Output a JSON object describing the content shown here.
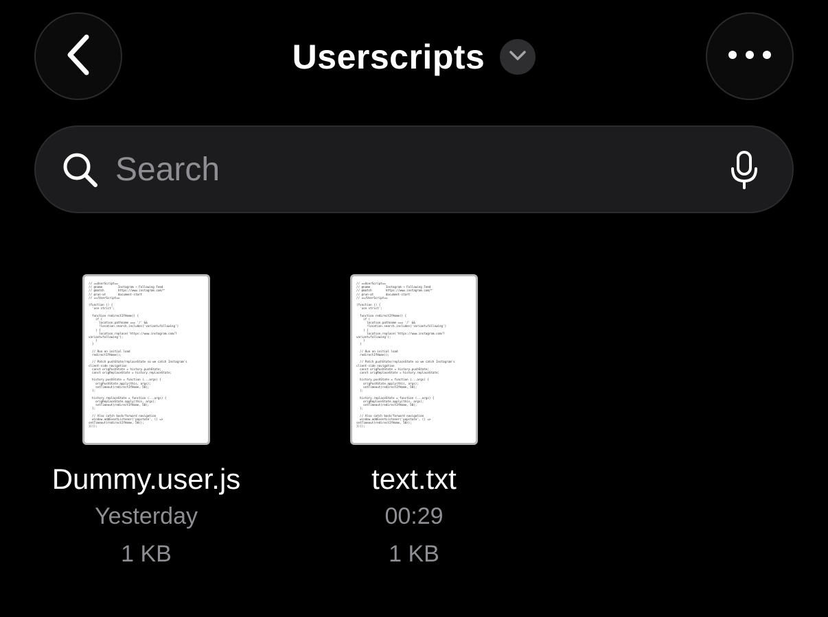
{
  "header": {
    "title": "Userscripts",
    "back_icon": "chevron-left-icon",
    "more_icon": "ellipsis-icon",
    "title_menu_icon": "chevron-down-icon"
  },
  "search": {
    "placeholder": "Search",
    "value": "",
    "search_icon": "search-icon",
    "mic_icon": "microphone-icon"
  },
  "files": [
    {
      "name": "Dummy.user.js",
      "date": "Yesterday",
      "size": "1 KB",
      "preview": "// ==UserScript==\n// @name         Instagram → Following Feed\n// @match        https://www.instagram.com/*\n// @run-at       document-start\n// ==/UserScript==\n\n(function () {\n  'use strict';\n\n  function redirectIfHome() {\n    if (\n      location.pathname === '/' &&\n      !location.search.includes('variant=following')\n    ) {\n      location.replace('https://www.instagram.com/?\nvariant=following');\n    }\n  }\n\n  // Run on initial load\n  redirectIfHome();\n\n  // Patch pushState/replaceState so we catch Instagram's\nclient-side navigation\n  const origPushState = history.pushState;\n  const origReplaceState = history.replaceState;\n\n  history.pushState = function (...args) {\n    origPushState.apply(this, args);\n    setTimeout(redirectIfHome, 50);\n  };\n\n  history.replaceState = function (...args) {\n    origReplaceState.apply(this, args);\n    setTimeout(redirectIfHome, 50);\n  };\n\n  // Also catch back/forward navigation\n  window.addEventListener('popstate', () =>\nsetTimeout(redirectIfHome, 50));\n})();"
    },
    {
      "name": "text.txt",
      "date": "00:29",
      "size": "1 KB",
      "preview": "// ==UserScript==\n// @name         Instagram → Following Feed\n// @match        https://www.instagram.com/*\n// @run-at       document-start\n// ==/UserScript==\n\n(function () {\n  'use strict';\n\n  function redirectIfHome() {\n    if (\n      location.pathname === '/' &&\n      !location.search.includes('variant=following')\n    ) {\n      location.replace('https://www.instagram.com/?\nvariant=following');\n    }\n  }\n\n  // Run on initial load\n  redirectIfHome();\n\n  // Patch pushState/replaceState so we catch Instagram's\nclient-side navigation\n  const origPushState = history.pushState;\n  const origReplaceState = history.replaceState;\n\n  history.pushState = function (...args) {\n    origPushState.apply(this, args);\n    setTimeout(redirectIfHome, 50);\n  };\n\n  history.replaceState = function (...args) {\n    origReplaceState.apply(this, args);\n    setTimeout(redirectIfHome, 50);\n  };\n\n  // Also catch back/forward navigation\n  window.addEventListener('popstate', () =>\nsetTimeout(redirectIfHome, 50));\n})();"
    }
  ]
}
